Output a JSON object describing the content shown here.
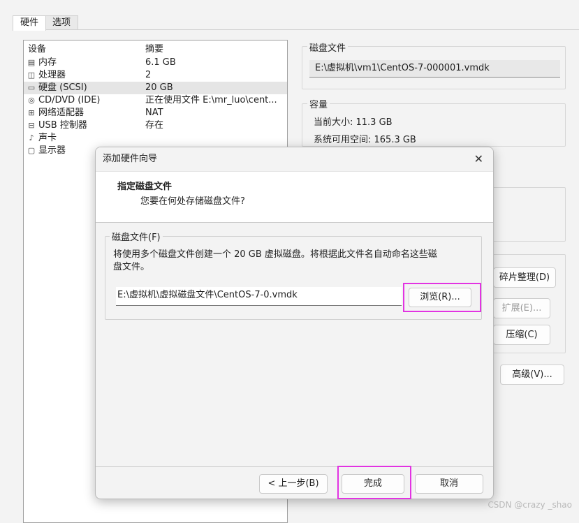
{
  "tabs": [
    {
      "label": "硬件"
    },
    {
      "label": "选项"
    }
  ],
  "device_list": {
    "col_device": "设备",
    "col_summary": "摘要",
    "items": [
      {
        "name": "内存",
        "summary": "6.1 GB",
        "icon": "memory-icon",
        "selected": false
      },
      {
        "name": "处理器",
        "summary": "2",
        "icon": "processor-icon",
        "selected": false
      },
      {
        "name": "硬盘 (SCSI)",
        "summary": "20 GB",
        "icon": "harddisk-icon",
        "selected": true
      },
      {
        "name": "CD/DVD (IDE)",
        "summary": "正在使用文件 E:\\mr_luo\\cent...",
        "icon": "cd-icon",
        "selected": false
      },
      {
        "name": "网络适配器",
        "summary": "NAT",
        "icon": "network-icon",
        "selected": false
      },
      {
        "name": "USB 控制器",
        "summary": "存在",
        "icon": "usb-icon",
        "selected": false
      },
      {
        "name": "声卡",
        "summary": "",
        "icon": "sound-icon",
        "selected": false
      },
      {
        "name": "显示器",
        "summary": "",
        "icon": "monitor-icon",
        "selected": false
      }
    ]
  },
  "disk_file": {
    "title": "磁盘文件",
    "path": "E:\\虚拟机\\vm1\\CentOS-7-000001.vmdk"
  },
  "capacity": {
    "title": "容量",
    "current_size": "当前大小: 11.3 GB",
    "free_space": "系统可用空间: 165.3 GB"
  },
  "right_buttons": {
    "defrag": "碎片整理(D)",
    "expand": "扩展(E)...",
    "compact": "压缩(C)",
    "advanced": "高级(V)..."
  },
  "dialog": {
    "title": "添加硬件向导",
    "close": "✕",
    "heading": "指定磁盘文件",
    "subheading": "您要在何处存储磁盘文件?",
    "group_label": "磁盘文件(F)",
    "description_line1": "将使用多个磁盘文件创建一个 20 GB 虚拟磁盘。将根据此文件名自动命名这些磁",
    "description_line2": "盘文件。",
    "file_path": "E:\\虚拟机\\虚拟磁盘文件\\CentOS-7-0.vmdk",
    "browse": "浏览(R)...",
    "back": "< 上一步(B)",
    "finish": "完成",
    "cancel": "取消"
  },
  "watermark": "CSDN @crazy _shao",
  "colors": {
    "highlight": "#e233e2",
    "selected_row": "#e5e5e5"
  }
}
